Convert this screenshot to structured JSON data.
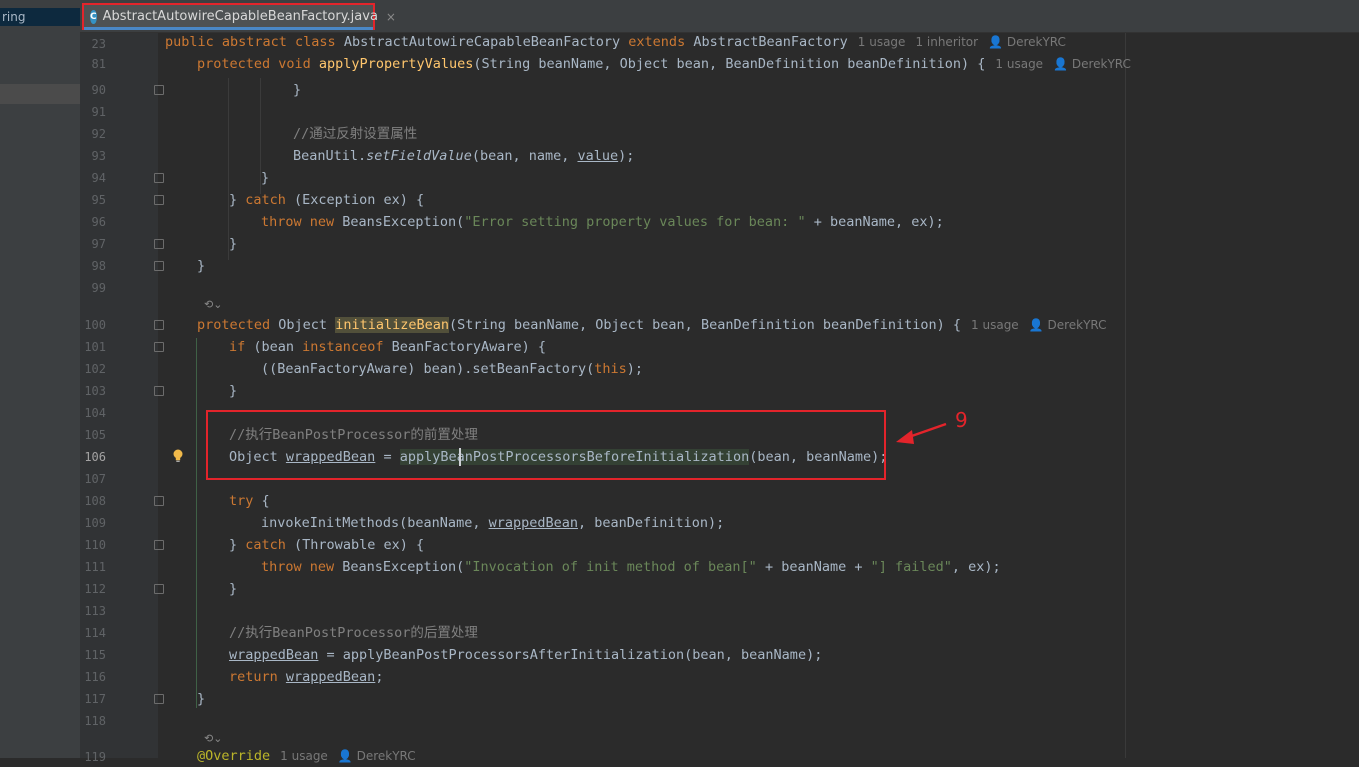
{
  "sidebar": {
    "project_label": "ring"
  },
  "tab": {
    "icon_letter": "C",
    "label": "AbstractAutowireCapableBeanFactory.java",
    "close_glyph": "×"
  },
  "line_numbers": [
    "23",
    "81",
    "90",
    "91",
    "92",
    "93",
    "94",
    "95",
    "96",
    "97",
    "98",
    "99",
    "100",
    "101",
    "102",
    "103",
    "104",
    "105",
    "106",
    "107",
    "108",
    "109",
    "110",
    "111",
    "112",
    "113",
    "114",
    "115",
    "116",
    "117",
    "118",
    "119"
  ],
  "inlay": {
    "usage_1": "1 usage",
    "inheritor_1": "1 inheritor",
    "author": "DerekYRC",
    "lens_glyph": "⟲⌄"
  },
  "code": {
    "l23_a": "public abstract class ",
    "l23_b": "AbstractAutowireCapableBeanFactory ",
    "l23_c": "extends ",
    "l23_d": "AbstractBeanFactory",
    "l81_a": "protected void ",
    "l81_b": "applyPropertyValues",
    "l81_c": "(String beanName, Object bean, BeanDefinition beanDefinition) {",
    "l90": "}",
    "l92": "//通过反射设置属性",
    "l93_a": "BeanUtil.",
    "l93_b": "setFieldValue",
    "l93_c": "(bean, name, ",
    "l93_d": "value",
    "l93_e": ");",
    "l94": "}",
    "l95_a": "} ",
    "l95_b": "catch ",
    "l95_c": "(Exception ex) {",
    "l96_a": "throw new ",
    "l96_b": "BeansException(",
    "l96_c": "\"Error setting property values for bean: \"",
    "l96_d": " + beanName, ex);",
    "l97": "}",
    "l98": "}",
    "l100_a": "protected ",
    "l100_b": "Object ",
    "l100_c": "initializeBean",
    "l100_d": "(String beanName, Object bean, BeanDefinition beanDefinition) {",
    "l101_a": "if ",
    "l101_b": "(bean ",
    "l101_c": "instanceof ",
    "l101_d": "BeanFactoryAware) {",
    "l102_a": "((BeanFactoryAware) bean).setBeanFactory(",
    "l102_b": "this",
    "l102_c": ");",
    "l103": "}",
    "l105": "//执行BeanPostProcessor的前置处理",
    "l106_a": "Object ",
    "l106_b": "wrappedBean",
    "l106_c": " = ",
    "l106_d": "applyBeanPostProcessorsBeforeInitialization",
    "l106_e": "(bean, beanName);",
    "l108_a": "try ",
    "l108_b": "{",
    "l109_a": "invokeInitMethods(beanName, ",
    "l109_b": "wrappedBean",
    "l109_c": ", beanDefinition);",
    "l110_a": "} ",
    "l110_b": "catch ",
    "l110_c": "(Throwable ex) {",
    "l111_a": "throw new ",
    "l111_b": "BeansException(",
    "l111_c": "\"Invocation of init method of bean[\"",
    "l111_d": " + beanName + ",
    "l111_e": "\"] failed\"",
    "l111_f": ", ex);",
    "l112": "}",
    "l114": "//执行BeanPostProcessor的后置处理",
    "l115_a": "wrappedBean",
    "l115_b": " = applyBeanPostProcessorsAfterInitialization(bean, beanName);",
    "l116_a": "return ",
    "l116_b": "wrappedBean",
    "l116_c": ";",
    "l117": "}",
    "l119_a": "@Override",
    "l119_b": "1 usage",
    "l119_c": "DerekYRC"
  },
  "annotation": {
    "number": "9"
  },
  "colors": {
    "annotation_red": "#e3242b",
    "keyword": "#cc7832",
    "method": "#ffc66d",
    "string": "#6a8759",
    "comment": "#808080"
  }
}
